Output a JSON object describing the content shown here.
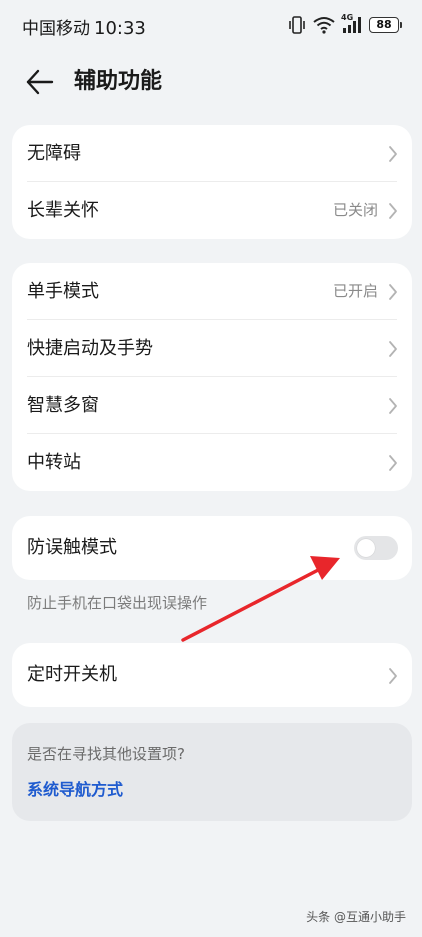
{
  "status_bar": {
    "carrier": "中国移动",
    "time": "10:33",
    "network_label": "4G",
    "battery": "88"
  },
  "header": {
    "title": "辅助功能",
    "back_icon": "arrow-left-icon"
  },
  "group1": [
    {
      "label": "无障碍",
      "value": ""
    },
    {
      "label": "长辈关怀",
      "value": "已关闭"
    }
  ],
  "group2": [
    {
      "label": "单手模式",
      "value": "已开启"
    },
    {
      "label": "快捷启动及手势",
      "value": ""
    },
    {
      "label": "智慧多窗",
      "value": ""
    },
    {
      "label": "中转站",
      "value": ""
    }
  ],
  "group3": {
    "label": "防误触模式",
    "toggle_on": false,
    "hint": "防止手机在口袋出现误操作"
  },
  "group4": [
    {
      "label": "定时开关机",
      "value": ""
    }
  ],
  "search_suggest": {
    "question": "是否在寻找其他设置项?",
    "link": "系统导航方式"
  },
  "watermark": "头条 @互通小助手",
  "colors": {
    "background": "#f1f3f5",
    "card": "#ffffff",
    "link": "#1f5bcf",
    "annotation_arrow": "#e8262b",
    "toggle_off": "#e4e5e7"
  }
}
